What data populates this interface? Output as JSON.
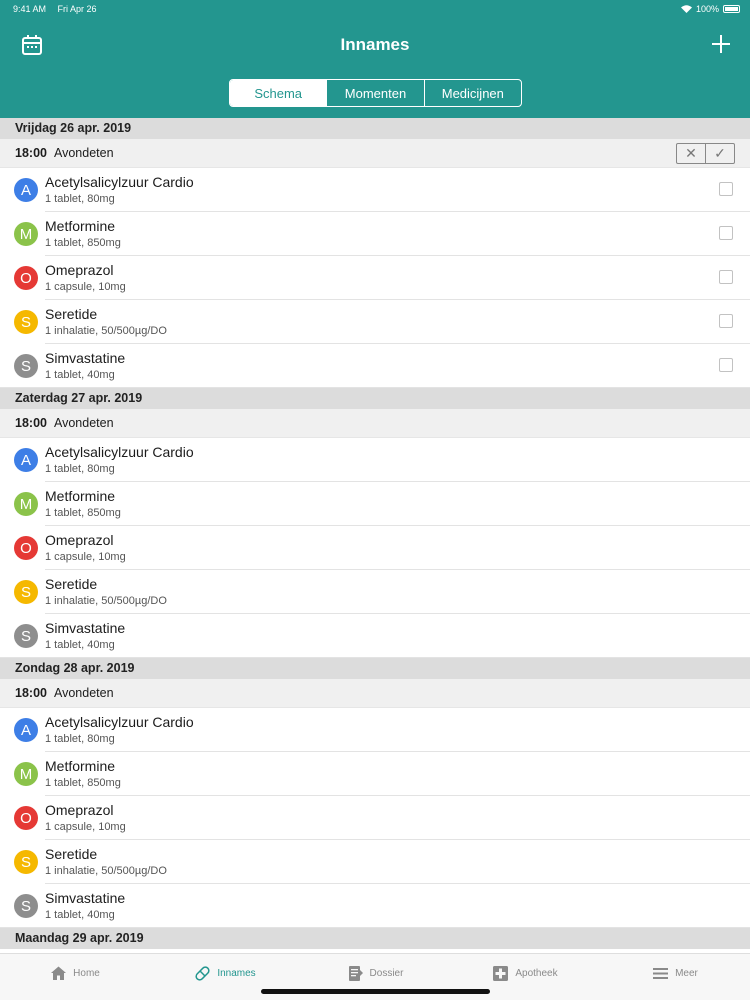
{
  "status_bar": {
    "time": "9:41 AM",
    "date": "Fri Apr 26",
    "battery": "100%"
  },
  "header": {
    "title": "Innames",
    "calendar_icon": "calendar-icon",
    "add_icon": "plus-icon"
  },
  "segments": [
    {
      "label": "Schema",
      "active": true
    },
    {
      "label": "Momenten",
      "active": false
    },
    {
      "label": "Medicijnen",
      "active": false
    }
  ],
  "colors": {
    "brand": "#23968f",
    "aspirin": "#3d7ee6",
    "metformine": "#8bc34a",
    "omeprazol": "#e53935",
    "seretide": "#f5b800",
    "simvastatine": "#8e8e8e"
  },
  "days": [
    {
      "date": "Vrijdag 26 apr. 2019",
      "moment": {
        "time": "18:00",
        "label": "Avondeten",
        "actions": true
      },
      "meds": [
        {
          "letter": "A",
          "color": "#3d7ee6",
          "name": "Acetylsalicylzuur Cardio",
          "dose": "1 tablet, 80mg",
          "checkbox": true
        },
        {
          "letter": "M",
          "color": "#8bc34a",
          "name": "Metformine",
          "dose": "1 tablet, 850mg",
          "checkbox": true
        },
        {
          "letter": "O",
          "color": "#e53935",
          "name": "Omeprazol",
          "dose": "1 capsule, 10mg",
          "checkbox": true
        },
        {
          "letter": "S",
          "color": "#f5b800",
          "name": "Seretide",
          "dose": "1 inhalatie, 50/500µg/DO",
          "checkbox": true
        },
        {
          "letter": "S",
          "color": "#8e8e8e",
          "name": "Simvastatine",
          "dose": "1 tablet, 40mg",
          "checkbox": true
        }
      ]
    },
    {
      "date": "Zaterdag 27 apr. 2019",
      "moment": {
        "time": "18:00",
        "label": "Avondeten",
        "actions": false
      },
      "meds": [
        {
          "letter": "A",
          "color": "#3d7ee6",
          "name": "Acetylsalicylzuur Cardio",
          "dose": "1 tablet, 80mg",
          "checkbox": false
        },
        {
          "letter": "M",
          "color": "#8bc34a",
          "name": "Metformine",
          "dose": "1 tablet, 850mg",
          "checkbox": false
        },
        {
          "letter": "O",
          "color": "#e53935",
          "name": "Omeprazol",
          "dose": "1 capsule, 10mg",
          "checkbox": false
        },
        {
          "letter": "S",
          "color": "#f5b800",
          "name": "Seretide",
          "dose": "1 inhalatie, 50/500µg/DO",
          "checkbox": false
        },
        {
          "letter": "S",
          "color": "#8e8e8e",
          "name": "Simvastatine",
          "dose": "1 tablet, 40mg",
          "checkbox": false
        }
      ]
    },
    {
      "date": "Zondag 28 apr. 2019",
      "moment": {
        "time": "18:00",
        "label": "Avondeten",
        "actions": false
      },
      "meds": [
        {
          "letter": "A",
          "color": "#3d7ee6",
          "name": "Acetylsalicylzuur Cardio",
          "dose": "1 tablet, 80mg",
          "checkbox": false
        },
        {
          "letter": "M",
          "color": "#8bc34a",
          "name": "Metformine",
          "dose": "1 tablet, 850mg",
          "checkbox": false
        },
        {
          "letter": "O",
          "color": "#e53935",
          "name": "Omeprazol",
          "dose": "1 capsule, 10mg",
          "checkbox": false
        },
        {
          "letter": "S",
          "color": "#f5b800",
          "name": "Seretide",
          "dose": "1 inhalatie, 50/500µg/DO",
          "checkbox": false
        },
        {
          "letter": "S",
          "color": "#8e8e8e",
          "name": "Simvastatine",
          "dose": "1 tablet, 40mg",
          "checkbox": false
        }
      ]
    },
    {
      "date": "Maandag 29 apr. 2019",
      "moment": null,
      "meds": []
    }
  ],
  "tabbar": [
    {
      "label": "Home",
      "icon": "home-icon",
      "active": false
    },
    {
      "label": "Innames",
      "icon": "pill-icon",
      "active": true
    },
    {
      "label": "Dossier",
      "icon": "dossier-icon",
      "active": false
    },
    {
      "label": "Apotheek",
      "icon": "pharmacy-cross-icon",
      "active": false
    },
    {
      "label": "Meer",
      "icon": "menu-icon",
      "active": false
    }
  ]
}
